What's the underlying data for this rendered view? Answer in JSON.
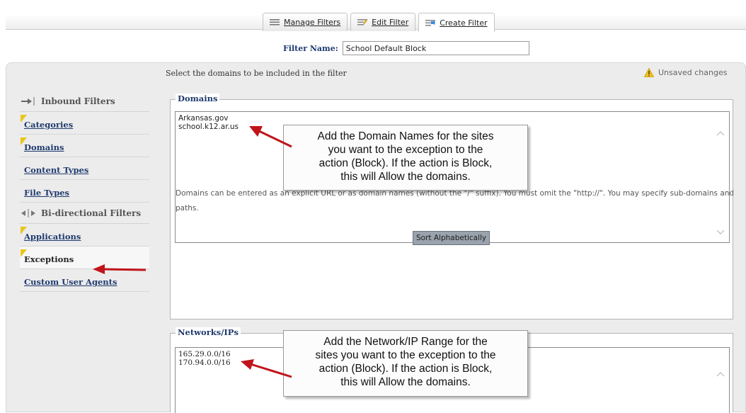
{
  "tabs": [
    {
      "label": "Manage Filters",
      "icon": "list-icon"
    },
    {
      "label": "Edit Filter",
      "icon": "edit-icon"
    },
    {
      "label": "Create Filter",
      "icon": "create-icon"
    }
  ],
  "filter_name": {
    "label": "Filter Name:",
    "value": "School Default Block"
  },
  "instruction": "Select the domains to be included in the filter",
  "status": {
    "text": "Unsaved changes",
    "icon": "warning-icon"
  },
  "sidebar": {
    "inbound_heading": "Inbound Filters",
    "inbound_items": [
      "Categories",
      "Domains",
      "Content Types",
      "File Types"
    ],
    "bidir_heading": "Bi-directional Filters",
    "bidir_items": [
      "Applications",
      "Exceptions",
      "Custom User Agents"
    ]
  },
  "domains_section": {
    "legend": "Domains",
    "entries": [
      "Arkansas.gov",
      "school.k12.ar.us"
    ],
    "help": "Domains can be entered as an explicit URL or as domain names (without the \"/\" suffix). You must omit the \"http://\". You may specify sub-domains and paths.",
    "sort_button": "Sort Alphabetically"
  },
  "networks_section": {
    "legend": "Networks/IPs",
    "entries": [
      "165.29.0.0/16",
      "170.94.0.0/16"
    ]
  },
  "callouts": {
    "domains": [
      "Add the Domain Names for the sites",
      "you want to the exception to the",
      "action (Block).  If the action is Block,",
      "this will Allow the domains."
    ],
    "networks": [
      "Add the Network/IP Range for the",
      "sites you want to the exception to the",
      "action (Block).  If the action is Block,",
      "this will Allow the domains."
    ]
  },
  "colors": {
    "link": "#1f3a6e",
    "annotation_arrow": "#c0141b",
    "flag": "#e8c51a",
    "panel": "#ececec"
  }
}
